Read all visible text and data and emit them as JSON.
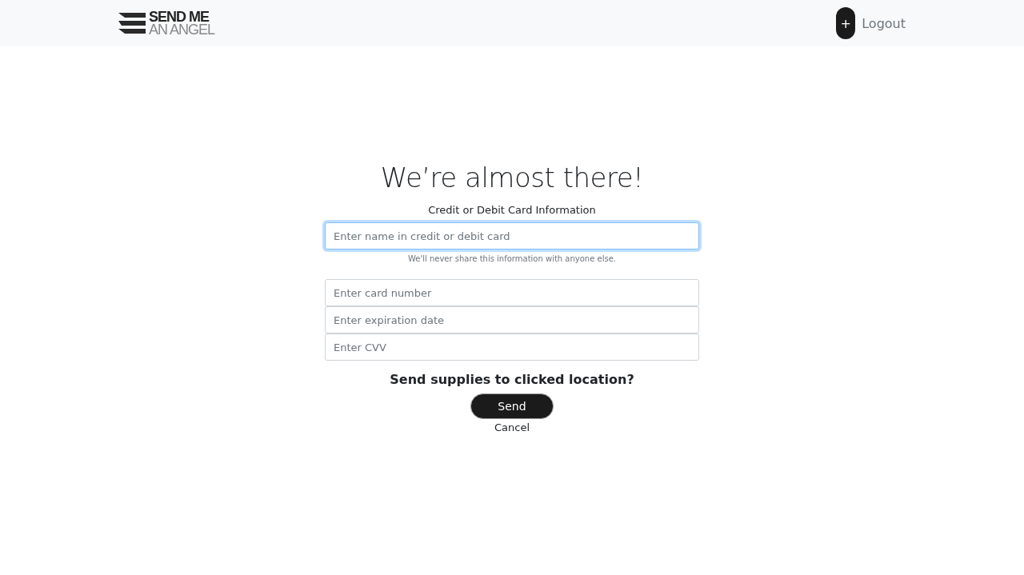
{
  "navbar": {
    "logo": {
      "line_1": "SEND ME",
      "line_2": "AN ANGEL"
    },
    "add_button": "+",
    "logout": "Logout"
  },
  "form": {
    "title": "We’re almost there!",
    "subtitle": "Credit or Debit Card Information",
    "fields": [
      {
        "placeholder": "Enter name in credit or debit card",
        "focused": true,
        "help": "We'll never share this information with anyone else."
      },
      {
        "placeholder": "Enter card number",
        "focused": false
      },
      {
        "placeholder": "Enter expiration date",
        "focused": false
      },
      {
        "placeholder": "Enter CVV",
        "focused": false
      }
    ],
    "question": "Send supplies to clicked location?",
    "send_button": "Send",
    "cancel_link": "Cancel"
  }
}
